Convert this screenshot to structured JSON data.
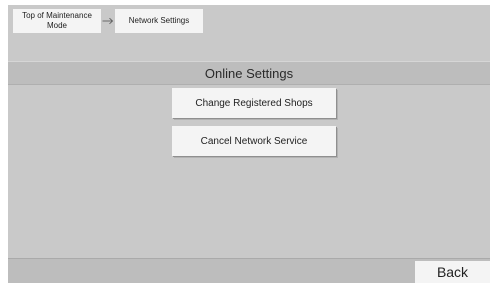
{
  "breadcrumb": {
    "items": [
      {
        "label": "Top of Maintenance Mode"
      },
      {
        "label": "Network Settings"
      }
    ],
    "separator_icon": "arrow-right-icon"
  },
  "page": {
    "title": "Online Settings"
  },
  "menu": {
    "buttons": [
      {
        "label": "Change Registered Shops"
      },
      {
        "label": "Cancel Network Service"
      }
    ]
  },
  "footer": {
    "back_label": "Back"
  },
  "colors": {
    "background": "#c9c9c9",
    "bar": "#bdbdbd",
    "button": "#f4f4f4",
    "text": "#222222"
  }
}
